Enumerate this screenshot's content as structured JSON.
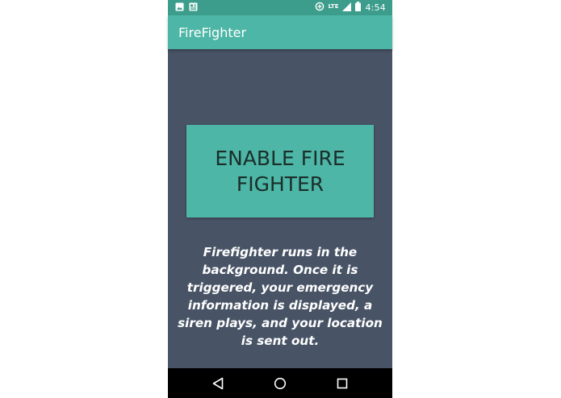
{
  "status_bar": {
    "network": "LTE",
    "time": "4:54",
    "left_icons": [
      "image-icon",
      "news-icon"
    ],
    "right_icons": [
      "data-saver-icon",
      "signal-icon",
      "battery-icon"
    ]
  },
  "app_bar": {
    "title": "FireFighter"
  },
  "main": {
    "enable_button_label": "ENABLE FIRE FIGHTER",
    "description": "Firefighter runs in the background. Once it is triggered, your emergency information is displayed, a siren plays, and your location is sent out."
  },
  "nav_bar": {
    "buttons": [
      "back-icon",
      "home-icon",
      "recents-icon"
    ]
  },
  "colors": {
    "status_bar": "#3d9d8c",
    "app_bar": "#4db6a6",
    "background": "#485466",
    "button": "#4db6a6",
    "button_text": "#1b2e2a",
    "nav_bar": "#000000"
  }
}
